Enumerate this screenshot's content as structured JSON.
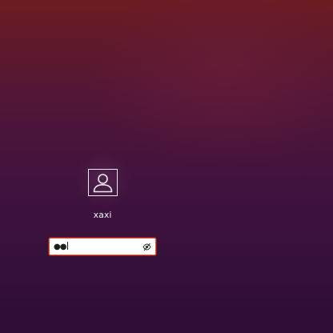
{
  "user": {
    "name": "xaxi",
    "avatar_icon": "user-avatar-icon"
  },
  "password": {
    "masked_value": "●●",
    "reveal_icon": "eye-slash-icon"
  },
  "colors": {
    "background_top": "#6b1c22",
    "background_bottom": "#2d0c35",
    "field_focus_border": "#e95420",
    "text": "#ffffff"
  }
}
